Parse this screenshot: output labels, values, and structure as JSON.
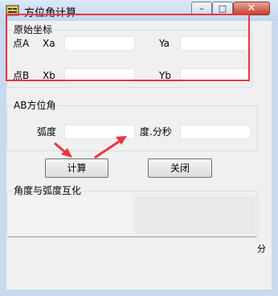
{
  "window": {
    "title": "方位角计算",
    "min_glyph": "–",
    "max_glyph": "□",
    "close_glyph": "✕"
  },
  "group_coords": {
    "title": "原始坐标",
    "point_a": "点A",
    "xa": "Xa",
    "ya": "Ya",
    "point_b": "点B",
    "xb": "Xb",
    "yb": "Yb",
    "xa_value": "",
    "ya_value": "",
    "xb_value": "",
    "yb_value": ""
  },
  "group_azimuth": {
    "title": "AB方位角",
    "radian_label": "弧度",
    "dms_label": "度.分秒",
    "radian_value": "",
    "dms_value": ""
  },
  "buttons": {
    "calc": "计算",
    "close": "关闭"
  },
  "group_convert": {
    "title": "角度与弧度互化",
    "clipped_glyph": "分"
  },
  "colors": {
    "highlight": "#e8363f",
    "annotation_arrow": "#e8363f"
  }
}
